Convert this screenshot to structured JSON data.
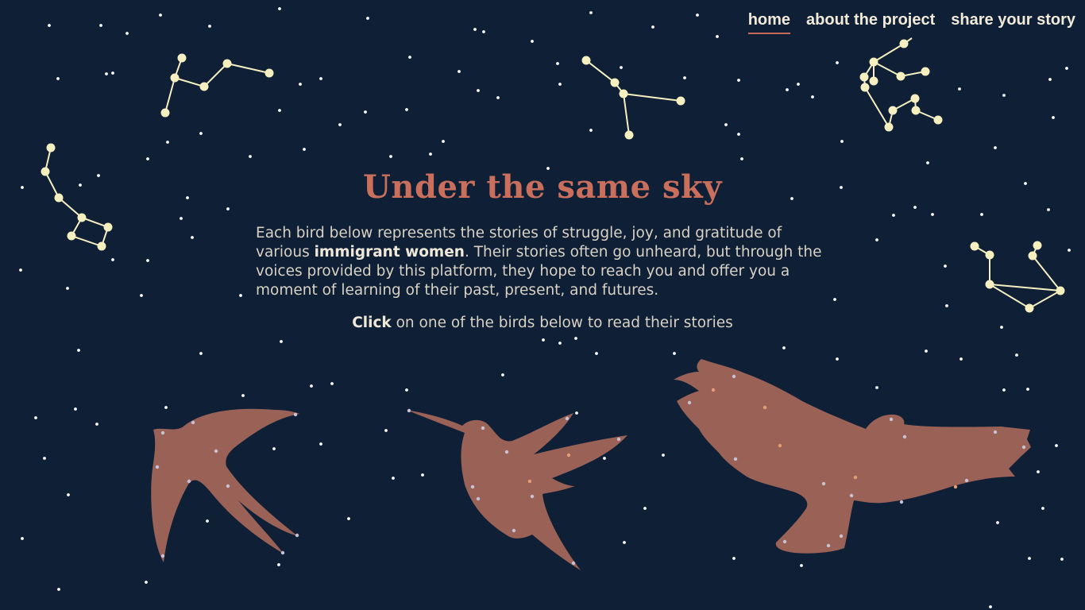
{
  "nav": {
    "home": "home",
    "about": "about the project",
    "share": "share your story"
  },
  "hero": {
    "title": "Under the same sky",
    "intro_part1": "Each bird below represents the stories of struggle, joy, and gratitude of various ",
    "intro_emphasis": "immigrant women",
    "intro_part2": ". Their stories often go unheard, but through the voices provided by this platform, they hope to reach you and offer you a moment of learning of their past, present, and futures.",
    "instruction_emphasis": "Click",
    "instruction_rest": " on one of the birds below to read their stories"
  },
  "birds": [
    {
      "icon": "swallow-icon"
    },
    {
      "icon": "hummingbird-icon"
    },
    {
      "icon": "eagle-icon"
    }
  ],
  "colors": {
    "background": "#0e1f36",
    "title": "#c96f5c",
    "bird": "#9a6257",
    "constellation": "#f6efc0",
    "text": "#d9d2c4"
  }
}
